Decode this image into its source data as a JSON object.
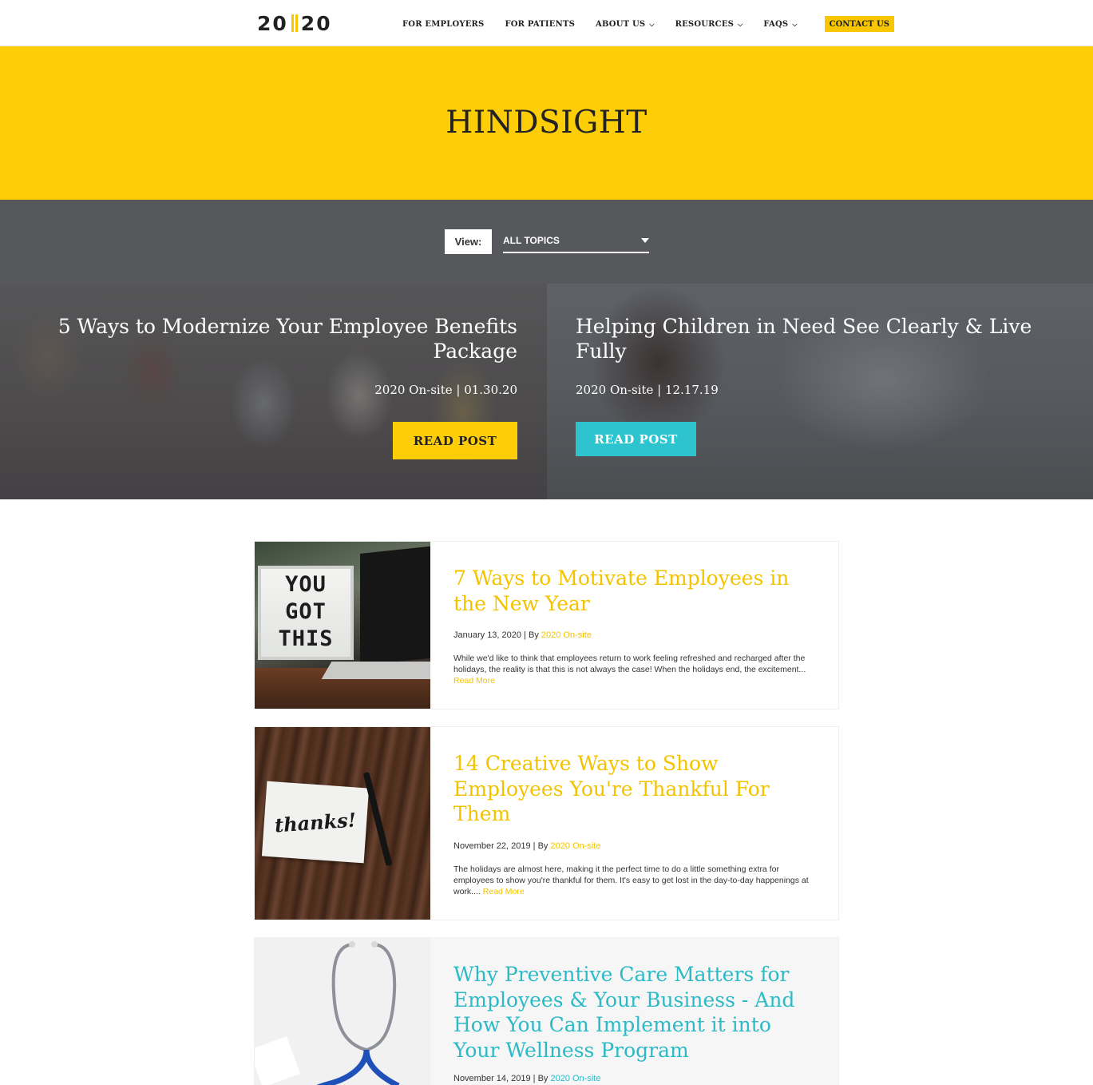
{
  "header": {
    "logo_left": "20",
    "logo_right": "20",
    "nav": [
      {
        "label": "FOR EMPLOYERS",
        "dropdown": false
      },
      {
        "label": "FOR PATIENTS",
        "dropdown": false
      },
      {
        "label": "ABOUT US",
        "dropdown": true
      },
      {
        "label": "RESOURCES",
        "dropdown": true
      },
      {
        "label": "FAQS",
        "dropdown": true
      }
    ],
    "contact_label": "CONTACT US"
  },
  "hero": {
    "title": "HINDSIGHT"
  },
  "filter": {
    "view_label": "View:",
    "selected": "ALL TOPICS"
  },
  "featured": [
    {
      "title": "5 Ways to Modernize Your Employee Benefits Package",
      "meta": "2020 On-site | 01.30.20",
      "button": "READ POST"
    },
    {
      "title": "Helping Children in Need See Clearly & Live Fully",
      "meta": "2020 On-site | 12.17.19",
      "button": "READ POST"
    }
  ],
  "posts": [
    {
      "title": "7 Ways to Motivate Employees in the New Year",
      "date": "January 13, 2020",
      "by": " | By ",
      "author": "2020 On-site",
      "excerpt": "While we'd like to think that employees return to work feeling refreshed and recharged after the holidays, the reality is that this is not always the case! When the holidays end, the excitement...",
      "more": "Read More",
      "image_text": [
        "YOU",
        "GOT",
        "THIS"
      ]
    },
    {
      "title": "14 Creative Ways to Show Employees You're Thankful For Them",
      "date": "November 22, 2019",
      "by": " | By ",
      "author": "2020 On-site",
      "excerpt": "The holidays are almost here, making it the perfect time to do a little something extra for employees to show you're thankful for them. It's easy to get lost in the day-to-day happenings at work....",
      "more": "Read More",
      "image_text": "thanks!"
    },
    {
      "title": "Why Preventive Care Matters for Employees & Your Business - And How You Can Implement it into Your Wellness Program",
      "date": "November 14, 2019",
      "by": " | By ",
      "author": "2020 On-site"
    }
  ],
  "colors": {
    "brand_yellow": "#fdcd07",
    "accent_teal": "#2ec4cf",
    "filter_gray": "#56585b"
  }
}
